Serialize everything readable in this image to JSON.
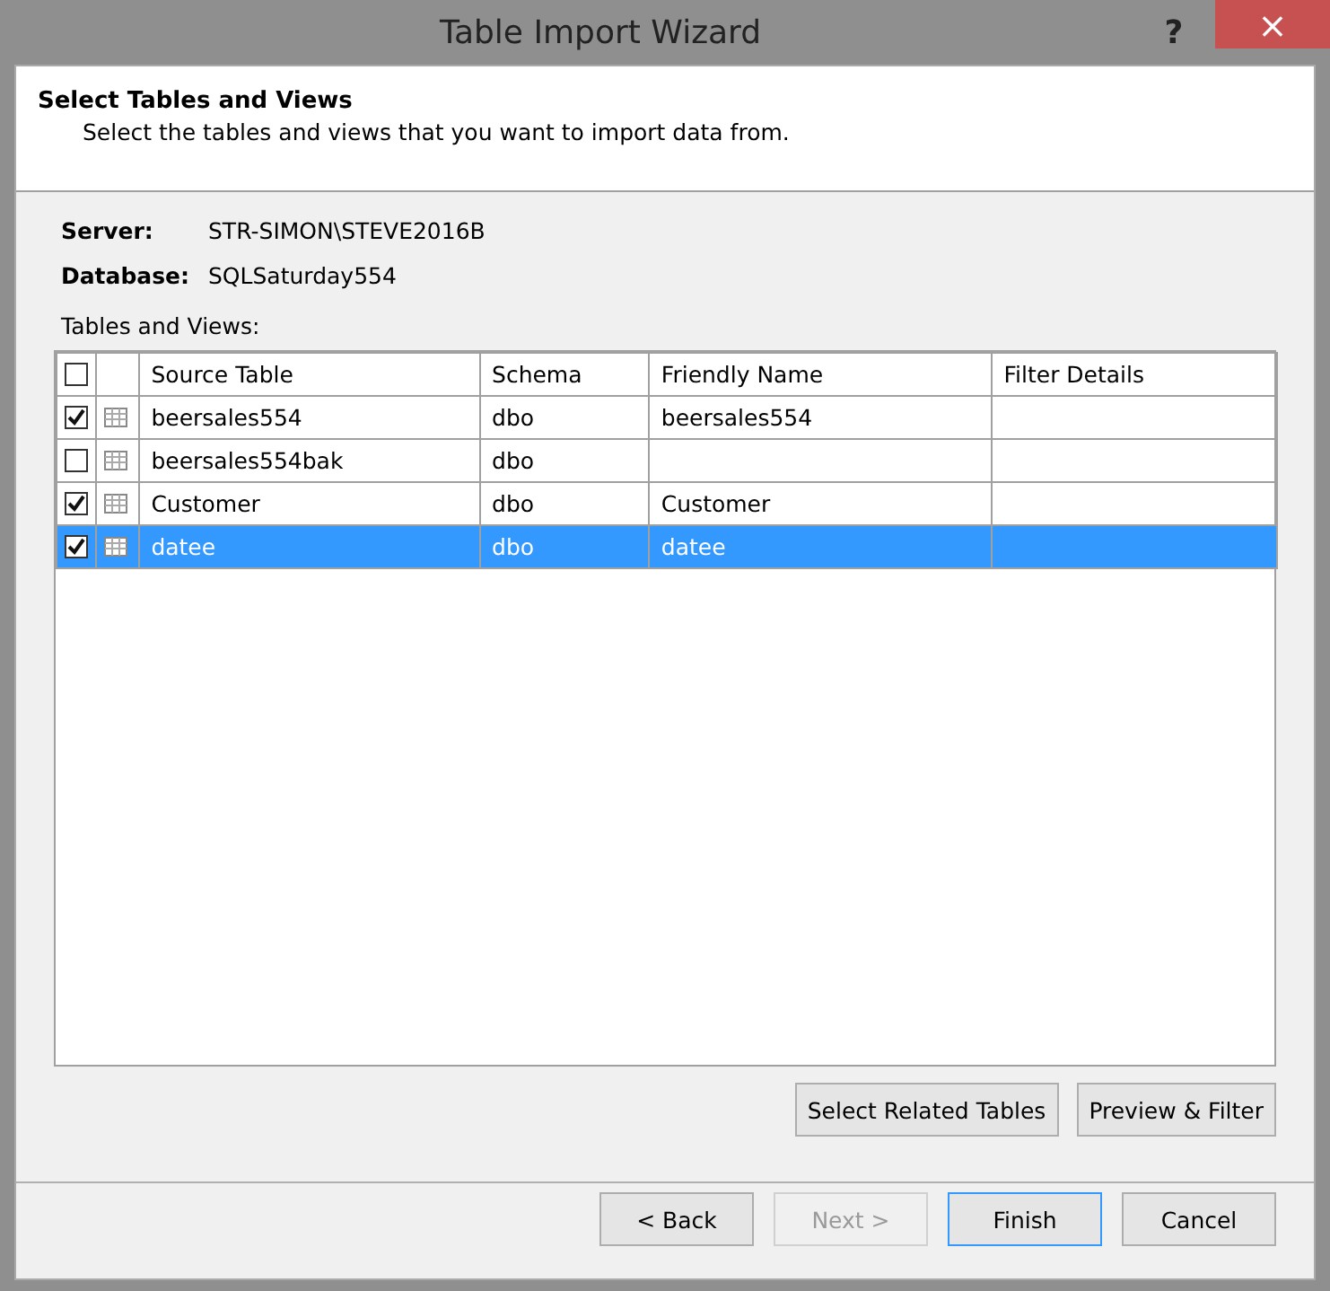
{
  "window": {
    "title": "Table Import Wizard",
    "help": "?",
    "close": "×"
  },
  "header": {
    "title": "Select Tables and Views",
    "subtitle": "Select the tables and views that you want to import data from."
  },
  "info": [
    {
      "label": "Server:",
      "value": "STR-SIMON\\STEVE2016B"
    },
    {
      "label": "Database:",
      "value": "SQLSaturday554"
    }
  ],
  "tables_label": "Tables and Views:",
  "table": {
    "select_all_checked": false,
    "columns": [
      "Source Table",
      "Schema",
      "Friendly Name",
      "Filter Details"
    ],
    "rows": [
      {
        "checked": true,
        "selected": false,
        "cells": [
          "beersales554",
          "dbo",
          "beersales554",
          ""
        ]
      },
      {
        "checked": false,
        "selected": false,
        "cells": [
          "beersales554bak",
          "dbo",
          "",
          ""
        ]
      },
      {
        "checked": true,
        "selected": false,
        "cells": [
          "Customer",
          "dbo",
          "Customer",
          ""
        ]
      },
      {
        "checked": true,
        "selected": true,
        "cells": [
          "datee",
          "dbo",
          "datee",
          ""
        ]
      }
    ]
  },
  "table_buttons": [
    "Select Related Tables",
    "Preview & Filter"
  ],
  "nav_buttons": [
    {
      "label": "< Back",
      "disabled": false,
      "default": false
    },
    {
      "label": "Next >",
      "disabled": true,
      "default": false
    },
    {
      "label": "Finish",
      "disabled": false,
      "default": true
    },
    {
      "label": "Cancel",
      "disabled": false,
      "default": false
    }
  ]
}
